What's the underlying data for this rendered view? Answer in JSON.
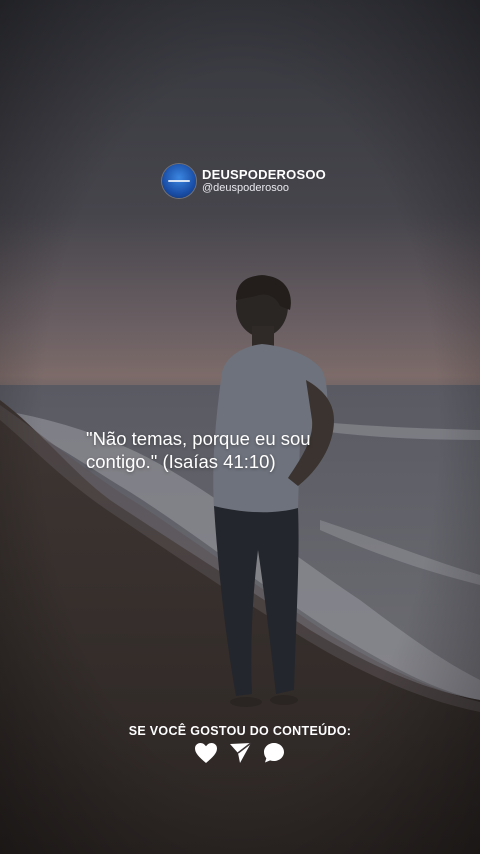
{
  "profile": {
    "name": "DEUSPODEROSOO",
    "handle": "@deuspoderosoo",
    "avatar_color": "#1a4fa8"
  },
  "quote": {
    "text": "\"Não temas, porque eu sou contigo.\" (Isaías 41:10)"
  },
  "cta": {
    "label": "SE VOCÊ GOSTOU DO CONTEÚDO:",
    "icons": [
      "heart-icon",
      "send-icon",
      "comment-icon"
    ]
  },
  "colors": {
    "sky_top": "#3a3b42",
    "sky_horizon": "#7a6a6a",
    "sand": "#3a302c",
    "text": "#ffffff"
  }
}
